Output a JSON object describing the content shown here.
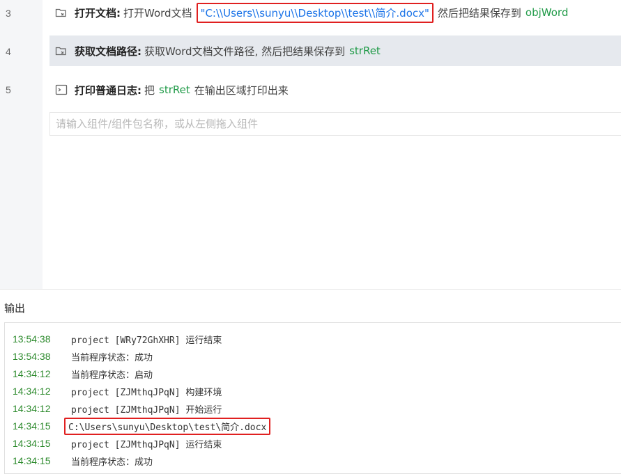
{
  "editor": {
    "rows": [
      {
        "line": "3",
        "title": "打开文档:",
        "text1": "打开Word文档",
        "path": "\"C:\\\\Users\\\\sunyu\\\\Desktop\\\\test\\\\简介.docx\"",
        "text2": "然后把结果保存到",
        "var": "objWord"
      },
      {
        "line": "4",
        "title": "获取文档路径:",
        "text1": "获取Word文档文件路径, 然后把结果保存到",
        "var": "strRet"
      },
      {
        "line": "5",
        "title": "打印普通日志:",
        "text1": "把",
        "var": "strRet",
        "text2": "在输出区域打印出来"
      }
    ],
    "component_input": {
      "placeholder": "请输入组件/组件包名称，或从左侧拖入组件",
      "value": ""
    }
  },
  "output": {
    "title": "输出",
    "logs": [
      {
        "time": "13:54:38",
        "message": "project [WRy72GhXHR] 运行结束"
      },
      {
        "time": "13:54:38",
        "message": "当前程序状态：成功"
      },
      {
        "time": "14:34:12",
        "message": "当前程序状态：启动"
      },
      {
        "time": "14:34:12",
        "message": "project [ZJMthqJPqN] 构建环境"
      },
      {
        "time": "14:34:12",
        "message": "project [ZJMthqJPqN] 开始运行"
      },
      {
        "time": "14:34:15",
        "message": "C:\\Users\\sunyu\\Desktop\\test\\简介.docx"
      },
      {
        "time": "14:34:15",
        "message": "project [ZJMthqJPqN] 运行结束"
      },
      {
        "time": "14:34:15",
        "message": "当前程序状态：成功"
      }
    ]
  },
  "colors": {
    "variable": "#1f9a47",
    "string": "#1a73e8",
    "highlight_border": "#e02020",
    "timestamp": "#2e8b2e"
  }
}
